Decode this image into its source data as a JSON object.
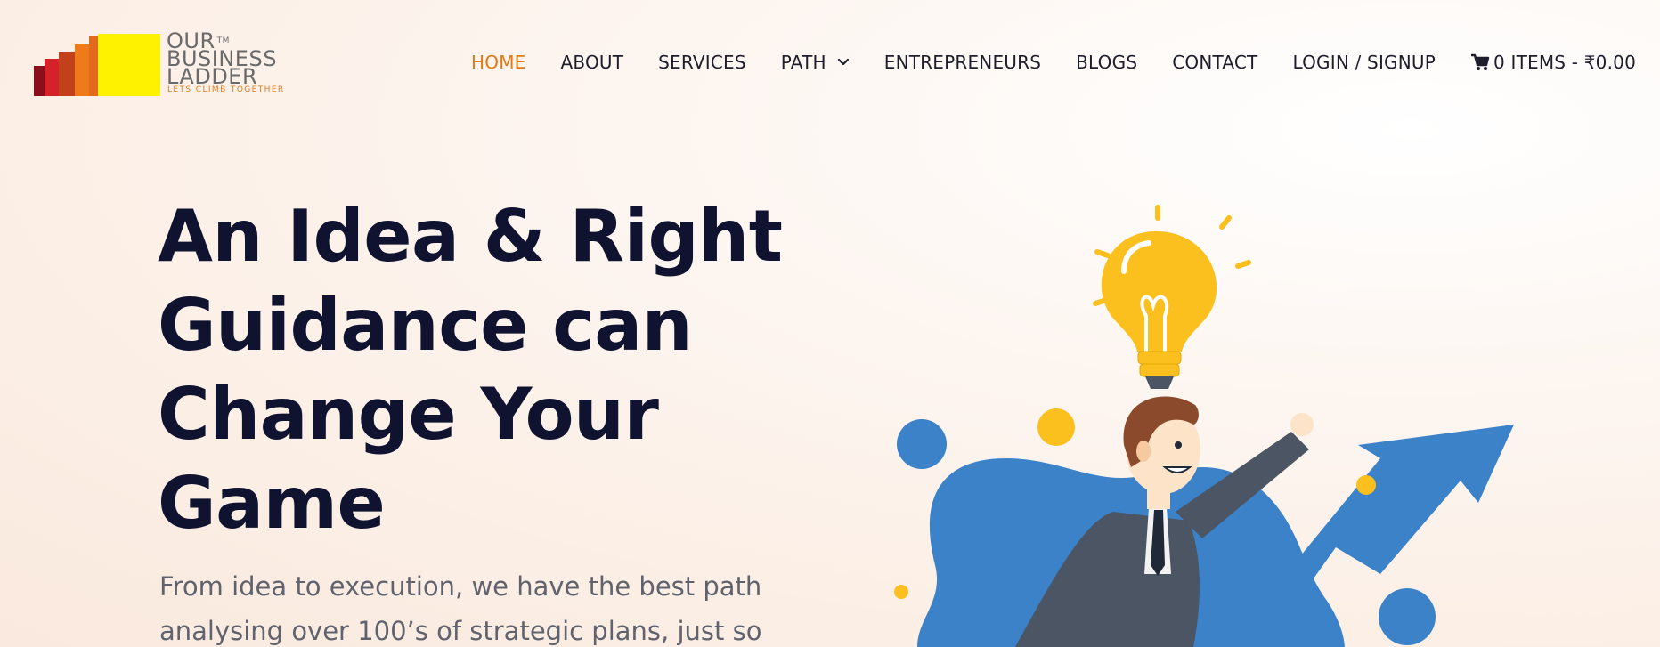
{
  "brand": {
    "line1": "OUR",
    "line2": "BUSINESS",
    "line3": "LADDER",
    "tm": "TM",
    "tagline": "LETS CLIMB TOGETHER",
    "bar_colors": [
      "#8b0f1a",
      "#d4212a",
      "#ef7a1a",
      "#c2411a",
      "#fff200"
    ]
  },
  "nav": {
    "home": "HOME",
    "about": "ABOUT",
    "services": "SERVICES",
    "path": "PATH",
    "entrepreneurs": "ENTREPRENEURS",
    "blogs": "BLOGS",
    "contact": "CONTACT",
    "login": "LOGIN / SIGNUP",
    "cart": "0 ITEMS - ₹0.00",
    "active_color": "#e07b12"
  },
  "hero": {
    "title_line1": "An Idea & Right",
    "title_line2": "Guidance can",
    "title_line3": "Change Your",
    "title_line4": "Game",
    "subtitle_line1": "From idea to execution, we have the best path",
    "subtitle_line2": "analysing over 100’s of strategic plans, just so"
  },
  "illustration": {
    "icons": [
      "lightbulb-icon",
      "businessman-figure",
      "arrow-up-icon"
    ],
    "colors": {
      "blue": "#3b82c9",
      "yellow": "#fbbf1e",
      "suit": "#4b5563",
      "cape": "#c0373c",
      "hair": "#8b4a2b"
    }
  }
}
